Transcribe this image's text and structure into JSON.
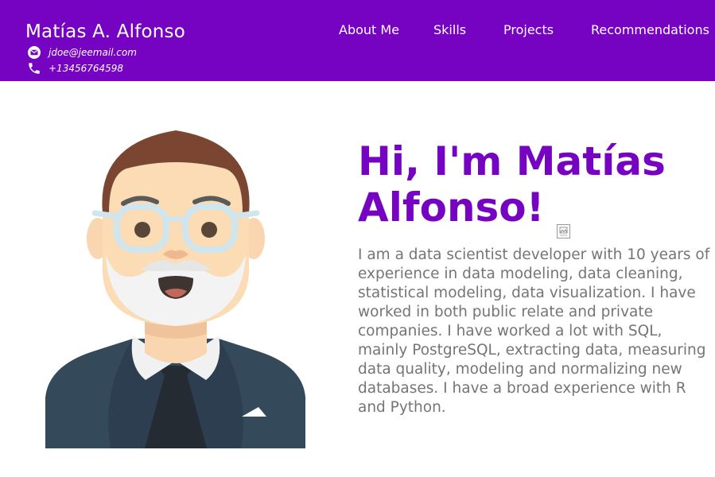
{
  "header": {
    "name": "Matías A. Alfonso",
    "email": "jdoe@jeemail.com",
    "phone": "+13456764598"
  },
  "nav": {
    "items": [
      {
        "label": "About Me"
      },
      {
        "label": "Skills"
      },
      {
        "label": "Projects"
      },
      {
        "label": "Recommendations"
      }
    ]
  },
  "hero": {
    "greeting": "Hi, I'm Matías Alfonso!",
    "intro": "I am a data scientist developer with 10 years of experience in data modeling, data cleaning, statistical modeling, data visualization. I have worked in both public relate and private companies. I have worked a lot with SQL, mainly PostgreSQL, extracting data, measuring data quality, modeling and normalizing new databases. I have a broad experience with R and Python."
  },
  "icons": {
    "email": "email-icon",
    "phone": "phone-icon",
    "avatar": "avatar-illustration",
    "broken_image": "broken-image-icon"
  },
  "colors": {
    "brand": "#7602c2",
    "header_text": "#ffffff",
    "body_text": "#757575",
    "background": "#ffffff"
  }
}
